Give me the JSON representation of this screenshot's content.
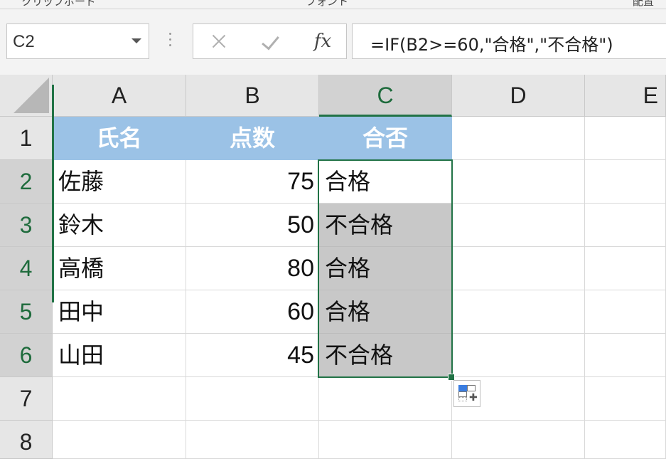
{
  "ribbon_fragments": [
    "クリップボード",
    "フォント",
    "配置"
  ],
  "name_box": {
    "value": "C2"
  },
  "formula_bar": {
    "cancel_icon": "close-icon",
    "enter_icon": "check-icon",
    "fx_label": "fx",
    "formula": "=IF(B2>=60,\"合格\",\"不合格\")"
  },
  "columns": [
    "A",
    "B",
    "C",
    "D",
    "E"
  ],
  "rows": [
    "1",
    "2",
    "3",
    "4",
    "5",
    "6",
    "7",
    "8"
  ],
  "table": {
    "headers": [
      "氏名",
      "点数",
      "合否"
    ],
    "records": [
      {
        "name": "佐藤",
        "score": "75",
        "result": "合格"
      },
      {
        "name": "鈴木",
        "score": "50",
        "result": "不合格"
      },
      {
        "name": "高橋",
        "score": "80",
        "result": "合格"
      },
      {
        "name": "田中",
        "score": "60",
        "result": "合格"
      },
      {
        "name": "山田",
        "score": "45",
        "result": "不合格"
      }
    ]
  },
  "selection": {
    "active_cell": "C2",
    "range": "C2:C6"
  },
  "colors": {
    "header_fill": "#9bc2e6",
    "selection_green": "#217346",
    "selection_shade": "#c8c8c8"
  },
  "quick_analysis_icon": "quick-analysis-icon"
}
